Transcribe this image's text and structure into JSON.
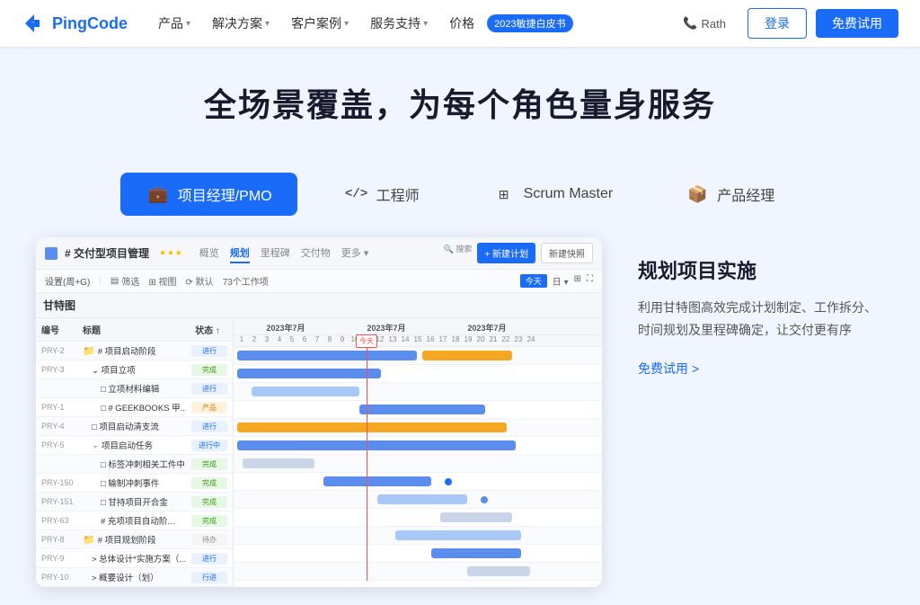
{
  "nav": {
    "logo_text": "PingCode",
    "menu_items": [
      {
        "label": "产品",
        "has_dropdown": true
      },
      {
        "label": "解决方案",
        "has_dropdown": true
      },
      {
        "label": "客户案例",
        "has_dropdown": true
      },
      {
        "label": "服务支持",
        "has_dropdown": true
      },
      {
        "label": "价格",
        "has_dropdown": false
      }
    ],
    "badge_text": "2023敏捷白皮书",
    "phone_text": "Rath",
    "login_label": "登录",
    "trial_label": "免费试用"
  },
  "hero": {
    "title": "全场景覆盖，为每个角色量身服务"
  },
  "roles": [
    {
      "label": "项目经理/PMO",
      "icon": "💼",
      "active": true
    },
    {
      "label": "工程师",
      "icon": "⌨",
      "active": false
    },
    {
      "label": "Scrum Master",
      "icon": "🔲",
      "active": false
    },
    {
      "label": "产品经理",
      "icon": "📦",
      "active": false
    }
  ],
  "gantt": {
    "title": "# 交付型项目管理",
    "tabs": [
      "概览",
      "规划",
      "里程碑",
      "交付物",
      "更多"
    ],
    "active_tab": "规划",
    "section_title": "甘特图",
    "toolbar_items": [
      "筛选",
      "视图",
      "默认",
      "73个工作项"
    ],
    "new_plan_btn": "+ 新建计划",
    "new_fast_btn": "新建快照",
    "today_label": "今天",
    "rows": [
      {
        "num": "PRY-2",
        "title": "# 项目启动阶段",
        "status": "进行",
        "status_type": "blue",
        "indent": 0,
        "is_group": true
      },
      {
        "num": "PRY-3",
        "title": "项目立项",
        "status": "完成",
        "status_type": "green",
        "indent": 1,
        "is_group": false
      },
      {
        "num": "",
        "title": "立项材料编辑",
        "status": "进行",
        "status_type": "blue",
        "indent": 2,
        "is_group": false
      },
      {
        "num": "PRY-1",
        "title": "# GEEKBOOKS 甲...",
        "status": "产品",
        "status_type": "orange",
        "indent": 2,
        "is_group": false
      },
      {
        "num": "PRY-4",
        "title": "项目启动清支流",
        "status": "进行",
        "status_type": "blue",
        "indent": 1,
        "is_group": false
      },
      {
        "num": "PRY-5",
        "title": "项目启动任务",
        "status": "进行中",
        "status_type": "blue",
        "indent": 1,
        "is_group": true
      },
      {
        "num": "",
        "title": "标签冲刺相关工件中",
        "status": "完成",
        "status_type": "green",
        "indent": 2,
        "is_group": false
      },
      {
        "num": "PRY-150",
        "title": "输制冲刺事件",
        "status": "完成",
        "status_type": "green",
        "indent": 2,
        "is_group": false
      },
      {
        "num": "PRY-151",
        "title": "甘持项目开合金",
        "status": "完成",
        "status_type": "green",
        "indent": 2,
        "is_group": false
      },
      {
        "num": "PRY-63",
        "title": "# 充项项目自动阶...",
        "status": "完成",
        "status_type": "green",
        "indent": 2,
        "is_group": false
      },
      {
        "num": "PRY-8",
        "title": "# 项目规划阶段",
        "status": "待办",
        "status_type": "gray",
        "indent": 0,
        "is_group": true
      },
      {
        "num": "PRY-9",
        "title": "> 总体设计*实施方案（...",
        "status": "进行",
        "status_type": "blue",
        "indent": 1,
        "is_group": false
      },
      {
        "num": "PRY-10",
        "title": "> 概要设计（划）",
        "status": "行进",
        "status_type": "blue",
        "indent": 1,
        "is_group": false
      }
    ]
  },
  "right_panel": {
    "title": "规划项目实施",
    "description": "利用甘特图高效完成计划制定、工作拆分、时间规划及里程碑确定，让交付更有序",
    "link_text": "免费试用 >"
  }
}
